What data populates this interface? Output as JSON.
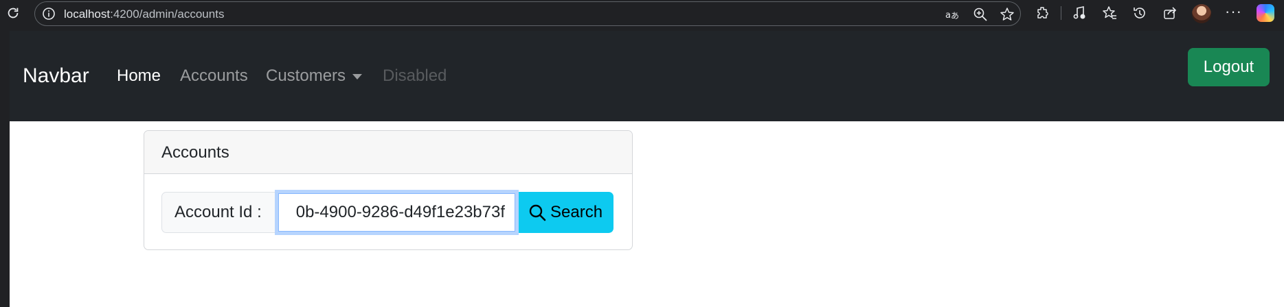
{
  "browser": {
    "url_host": "localhost",
    "url_path": ":4200/admin/accounts"
  },
  "navbar": {
    "brand": "Navbar",
    "links": [
      {
        "label": "Home"
      },
      {
        "label": "Accounts"
      },
      {
        "label": "Customers"
      },
      {
        "label": "Disabled"
      }
    ],
    "logout_label": "Logout"
  },
  "card": {
    "title": "Accounts",
    "account_label": "Account Id :",
    "account_value": "0b-4900-9286-d49f1e23b73f",
    "search_label": "Search"
  },
  "colors": {
    "navbar_bg": "#212529",
    "logout_bg": "#198754",
    "search_bg": "#0dcaf0"
  }
}
